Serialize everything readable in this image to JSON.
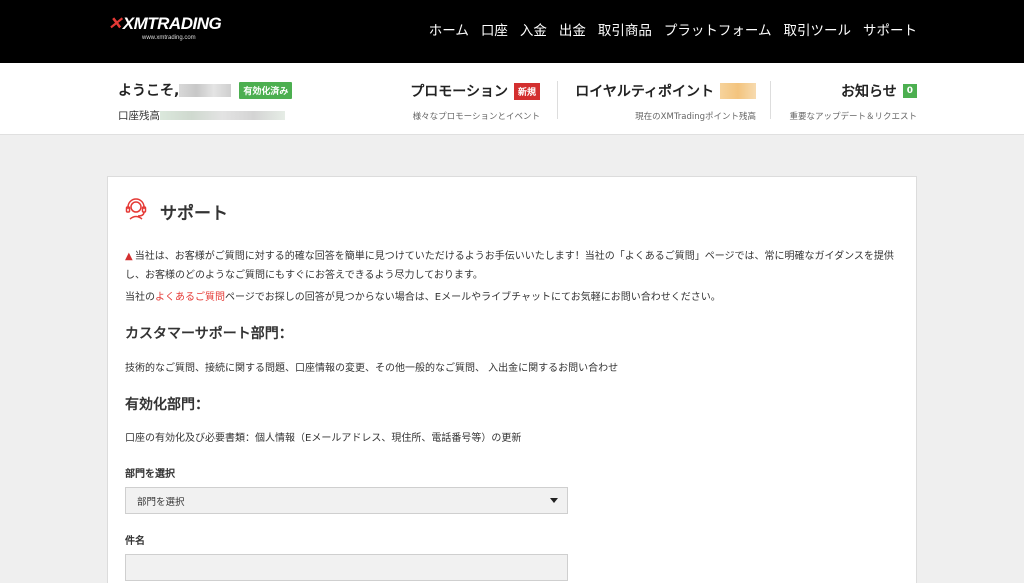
{
  "brand": {
    "logo_text": "XMTRADING",
    "logo_sub": "www.xmtrading.com",
    "accent": "#e53935"
  },
  "nav": {
    "items": [
      {
        "label": "ホーム"
      },
      {
        "label": "口座"
      },
      {
        "label": "入金"
      },
      {
        "label": "出金"
      },
      {
        "label": "取引商品"
      },
      {
        "label": "プラットフォーム"
      },
      {
        "label": "取引ツール"
      },
      {
        "label": "サポート"
      }
    ]
  },
  "account": {
    "welcome": "ようこそ,",
    "verified_badge": "有効化済み",
    "balance_label": "口座残高"
  },
  "promotions": {
    "title": "プロモーション",
    "badge": "新規",
    "subtitle": "様々なプロモーションとイベント"
  },
  "loyalty": {
    "title": "ロイヤルティポイント",
    "subtitle": "現在のXMTradingポイント残高"
  },
  "notices": {
    "title": "お知らせ",
    "count": "0",
    "subtitle": "重要なアップデート＆リクエスト"
  },
  "support": {
    "title": "サポート",
    "intro": "当社は、お客様がご質問に対する的確な回答を簡単に見つけていただけるようお手伝いいたします！当社の「よくあるご質問」ページでは、常に明確なガイダンスを提供し、お客様のどのようなご質問にもすぐにお答えできるよう尽力しております。",
    "intro2_prefix": "当社の",
    "faq_link": "よくあるご質問",
    "intro2_suffix": "ページでお探しの回答が見つからない場合は、Eメールやライブチャットにてお気軽にお問い合わせください。",
    "customer_support_title": "カスタマーサポート部門：",
    "customer_support_text": "技術的なご質問、接続に関する問題、口座情報の変更、その他一般的なご質問、 入出金に関するお問い合わせ",
    "activation_title": "有効化部門：",
    "activation_text": "口座の有効化及び必要書類：個人情報（Eメールアドレス、現住所、電話番号等）の更新",
    "department_label": "部門を選択",
    "department_selected": "部門を選択",
    "subject_label": "件名",
    "subject_value": ""
  }
}
